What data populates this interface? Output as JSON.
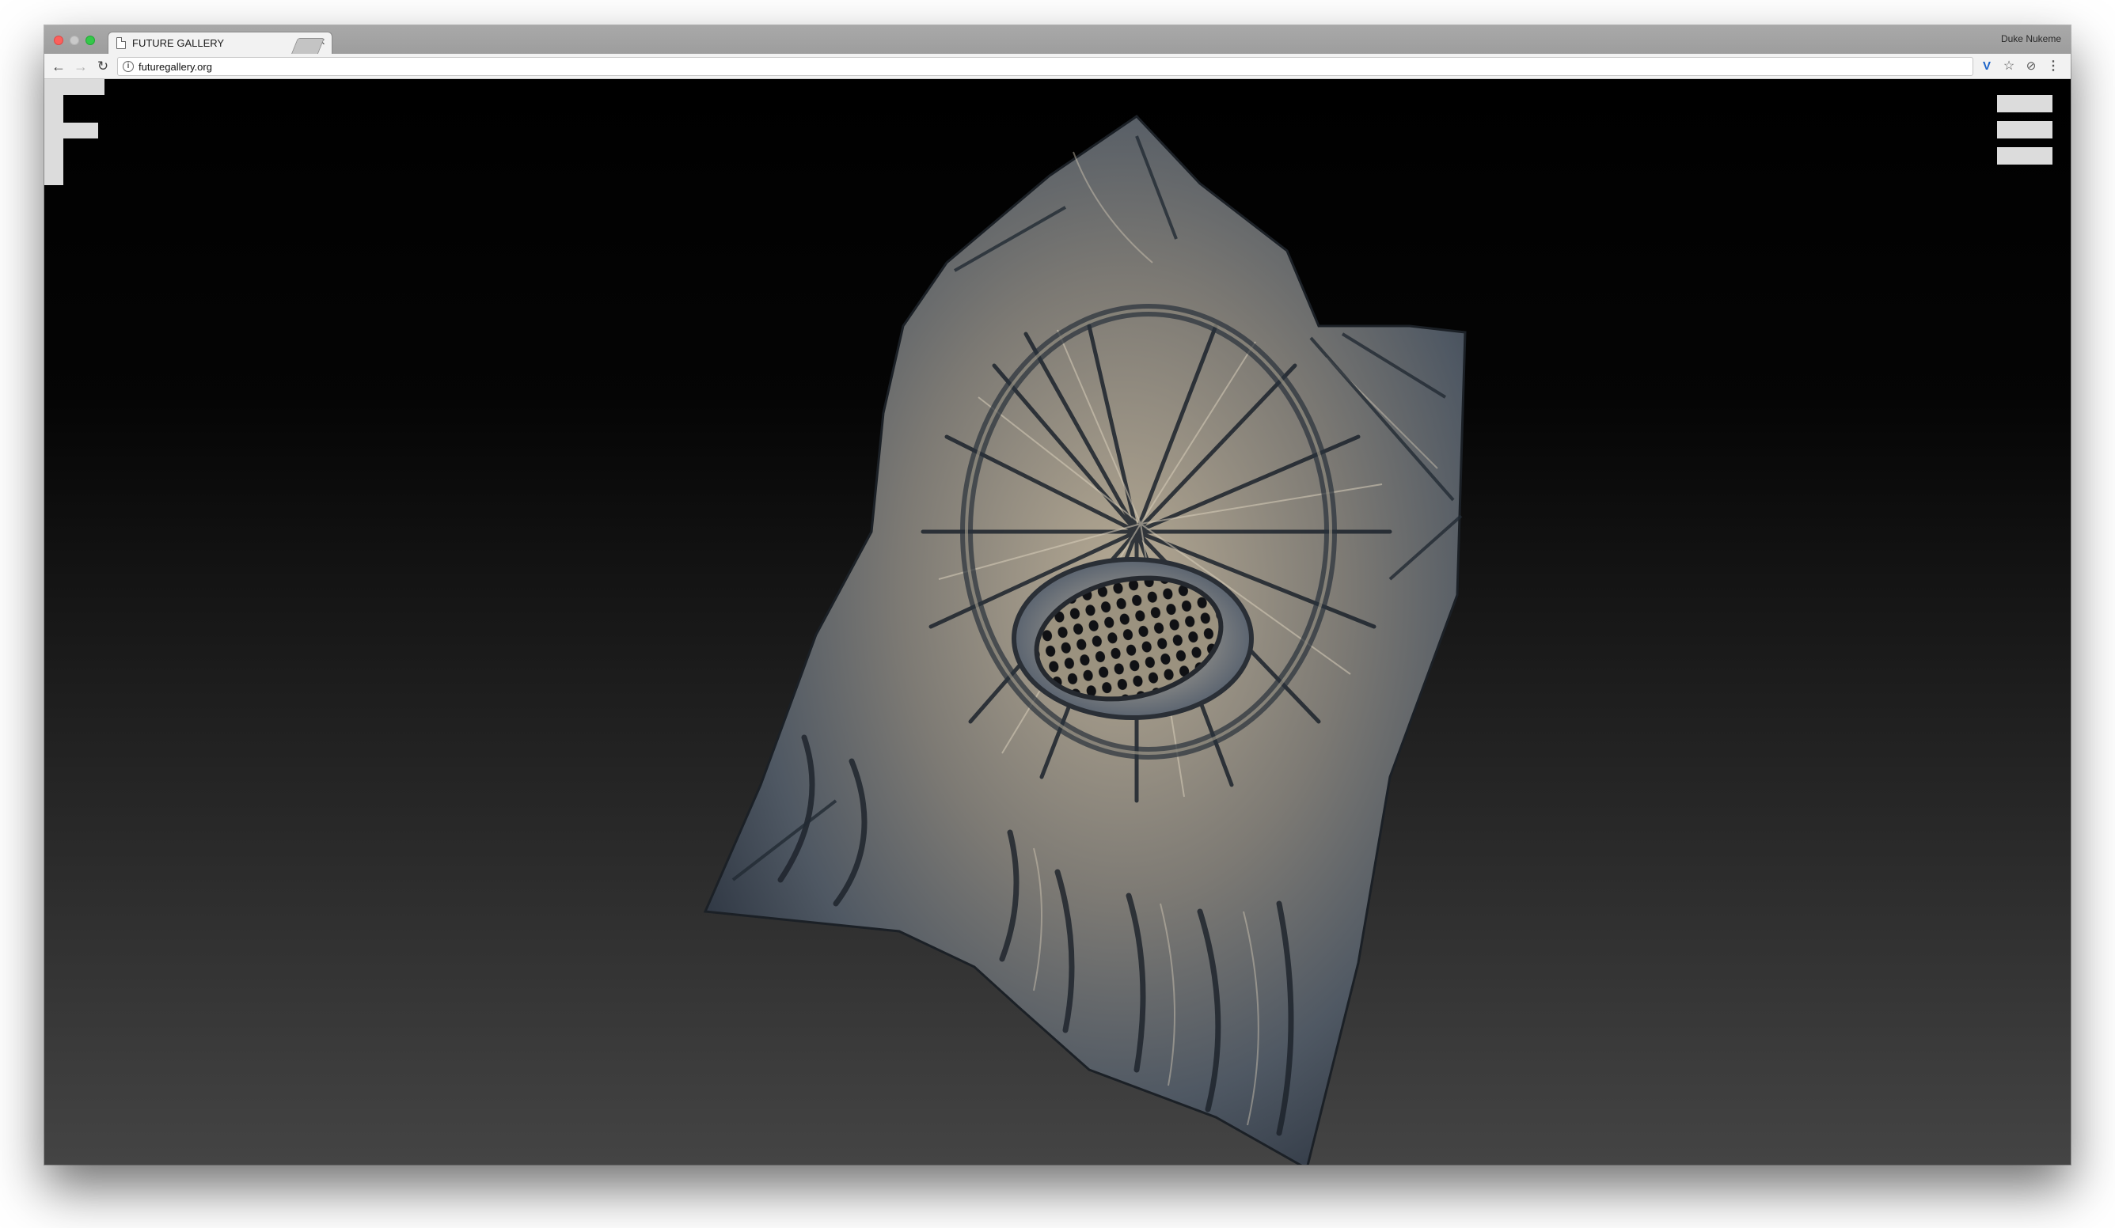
{
  "browser": {
    "tab_title": "FUTURE GALLERY",
    "tab_close": "×",
    "profile_name": "Duke Nukeme",
    "url": "futuregallery.org",
    "icons": {
      "back": "←",
      "forward": "→",
      "reload": "↻",
      "info": "i",
      "extension": "V",
      "star": "☆",
      "extension2": "⊘",
      "menu": "⋮"
    }
  },
  "colors": {
    "close": "#fc605c",
    "minimize": "#c9c9c9",
    "zoom": "#34c84a",
    "logo": "#dcdcdc",
    "page_top": "#000000",
    "page_bottom": "#444444"
  }
}
